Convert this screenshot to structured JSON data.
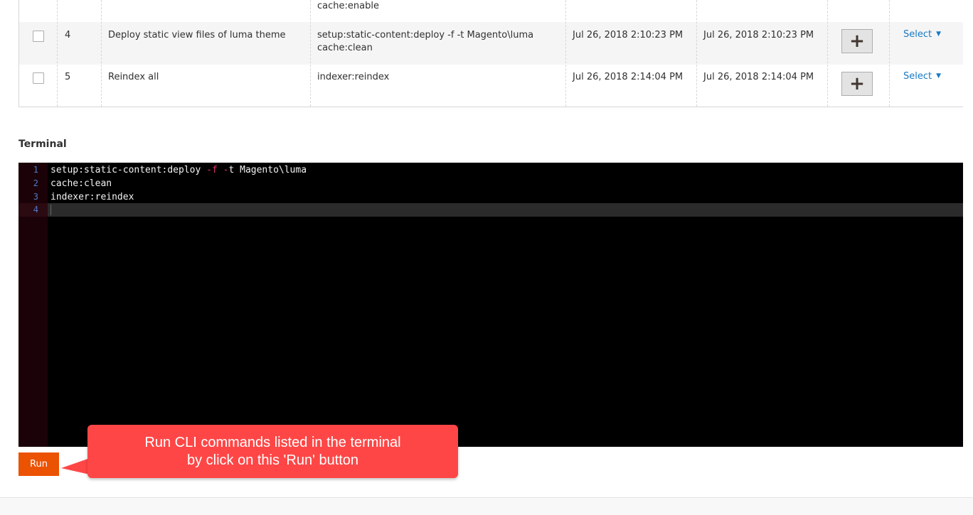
{
  "table": {
    "partial_row": {
      "command": "cache:enable"
    },
    "rows": [
      {
        "id": "4",
        "title": "Deploy static view files of luma theme",
        "command_line1": "setup:static-content:deploy -f -t Magento\\luma",
        "command_line2": "cache:clean",
        "created": "Jul 26, 2018 2:10:23 PM",
        "updated": "Jul 26, 2018 2:10:23 PM",
        "add_label": "+",
        "action_label": "Select"
      },
      {
        "id": "5",
        "title": "Reindex all",
        "command_line1": "indexer:reindex",
        "command_line2": "",
        "created": "Jul 26, 2018 2:14:04 PM",
        "updated": "Jul 26, 2018 2:14:04 PM",
        "add_label": "+",
        "action_label": "Select"
      }
    ]
  },
  "terminal": {
    "title": "Terminal",
    "line_numbers": [
      "1",
      "2",
      "3",
      "4"
    ],
    "lines": {
      "l1_a": "setup:static-content:deploy ",
      "l1_flag1": "-f",
      "l1_b": " ",
      "l1_flag2": "-",
      "l1_c": "t Magento\\luma",
      "l2": "cache:clean",
      "l3": "indexer:reindex",
      "l4": ""
    }
  },
  "run_button": {
    "label": "Run",
    "color": "#eb5202"
  },
  "callout": {
    "line1": "Run CLI commands listed in the terminal",
    "line2": "by click on this 'Run' button",
    "color": "#ff4646"
  }
}
